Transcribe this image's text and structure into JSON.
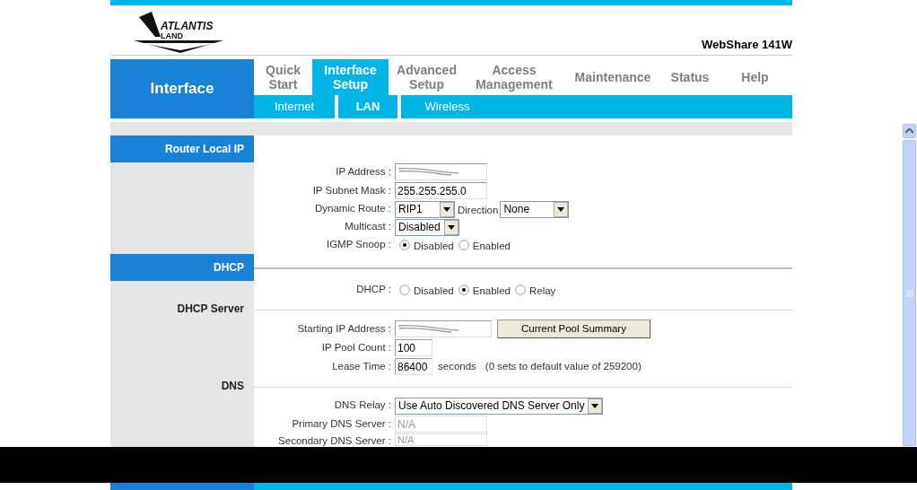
{
  "logo": {
    "text": "ATLANTIS",
    "subtext": "LAND"
  },
  "product": "WebShare 141W",
  "section_title": "Interface",
  "tabs": [
    {
      "lines": [
        "Quick",
        "Start"
      ],
      "selected": false
    },
    {
      "lines": [
        "Interface",
        "Setup"
      ],
      "selected": true
    },
    {
      "lines": [
        "Advanced",
        "Setup"
      ],
      "selected": false
    },
    {
      "lines": [
        "Access",
        "Management"
      ],
      "selected": false
    },
    {
      "lines": [
        "Maintenance"
      ],
      "selected": false
    },
    {
      "lines": [
        "Status"
      ],
      "selected": false
    },
    {
      "lines": [
        "Help"
      ],
      "selected": false
    }
  ],
  "subtabs": [
    {
      "label": "Internet",
      "selected": false
    },
    {
      "label": "LAN",
      "selected": true
    },
    {
      "label": "Wireless",
      "selected": false
    }
  ],
  "sections": [
    {
      "kind": "header",
      "title": "Router Local IP",
      "divider": false,
      "rows": [
        {
          "kind": "text",
          "label": "IP Address :",
          "redacted": true
        },
        {
          "kind": "text",
          "label": "IP Subnet Mask :",
          "value": "255.255.255.0"
        },
        {
          "kind": "select",
          "label": "Dynamic Route :",
          "value": "RIP1",
          "extra_label": "Direction",
          "extra_value": "None"
        },
        {
          "kind": "select",
          "label": "Multicast :",
          "value": "Disabled"
        },
        {
          "kind": "radio",
          "label": "IGMP Snoop :",
          "options": [
            {
              "label": "Disabled",
              "selected": true
            },
            {
              "label": "Enabled",
              "selected": false
            }
          ]
        }
      ]
    },
    {
      "kind": "header",
      "title": "DHCP",
      "divider": true,
      "rows": [
        {
          "kind": "radio",
          "label": "DHCP :",
          "options": [
            {
              "label": "Disabled",
              "selected": false
            },
            {
              "label": "Enabled",
              "selected": true
            },
            {
              "label": "Relay",
              "selected": false
            }
          ]
        }
      ]
    },
    {
      "kind": "subheader",
      "title": "DHCP Server",
      "divider": true,
      "rows": [
        {
          "kind": "text",
          "label": "Starting IP Address :",
          "redacted": true,
          "button": "Current Pool Summary"
        },
        {
          "kind": "text",
          "label": "IP Pool Count :",
          "value": "100"
        },
        {
          "kind": "text",
          "label": "Lease Time :",
          "value": "86400",
          "unit": "seconds",
          "note": "(0 sets to default value of 259200)"
        }
      ]
    },
    {
      "kind": "subheader",
      "title": "DNS",
      "divider": true,
      "rows": [
        {
          "kind": "select",
          "label": "DNS Relay :",
          "value": "Use Auto Discovered DNS Server Only"
        },
        {
          "kind": "text",
          "label": "Primary DNS Server :",
          "value": "N/A",
          "disabled": true
        },
        {
          "kind": "text",
          "label": "Secondary DNS Server :",
          "value": "N/A",
          "disabled": true
        }
      ]
    }
  ]
}
